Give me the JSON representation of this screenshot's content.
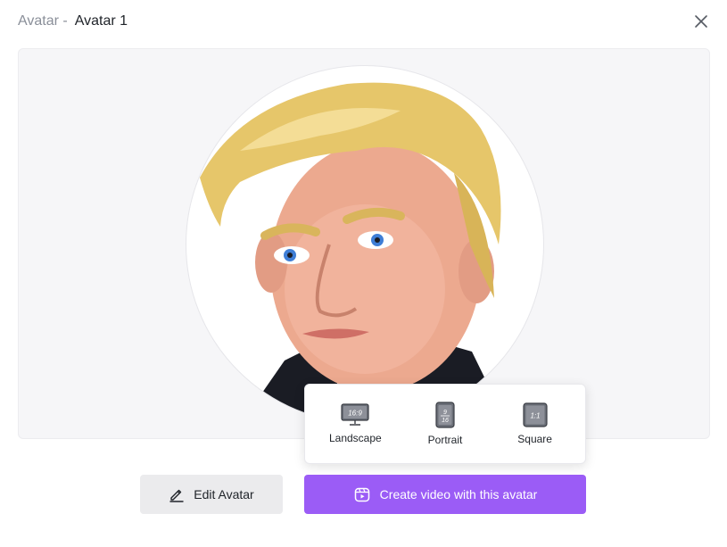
{
  "dialog": {
    "title_prefix": "Avatar -",
    "avatar_name": "Avatar 1"
  },
  "icons": {
    "close": "close-icon",
    "edit": "pencil-icon",
    "create": "video-camera-icon",
    "landscape": "landscape-ratio-icon",
    "portrait": "portrait-ratio-icon",
    "square": "square-ratio-icon"
  },
  "ratio_menu": {
    "options": [
      {
        "label": "Landscape",
        "ratio_text": "16:9"
      },
      {
        "label": "Portrait",
        "ratio_text_top": "9",
        "ratio_text_bottom": "16"
      },
      {
        "label": "Square",
        "ratio_text": "1:1"
      }
    ]
  },
  "actions": {
    "edit_label": "Edit Avatar",
    "create_label": "Create video with this avatar"
  },
  "colors": {
    "accent": "#9b5cf6",
    "secondary_button": "#ebebed",
    "preview_bg": "#f6f6f8"
  }
}
